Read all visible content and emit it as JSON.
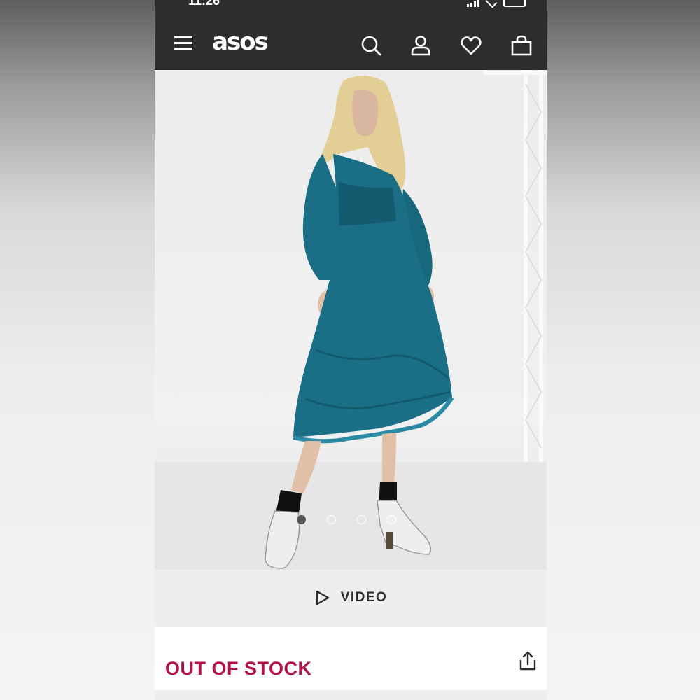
{
  "status_bar": {
    "time": "11:26"
  },
  "header": {
    "logo_text": "asos",
    "icons": [
      "menu-icon",
      "search-icon",
      "account-icon",
      "heart-icon",
      "bag-icon"
    ]
  },
  "gallery": {
    "image_count": 4,
    "active_index": 0,
    "dress_color": "#1a6f86"
  },
  "video": {
    "label": "VIDEO",
    "icon": "play-icon"
  },
  "product": {
    "stock_status": "OUT OF STOCK",
    "share_icon": "share-icon"
  },
  "colors": {
    "header_bg": "#2d2d2d",
    "out_of_stock": "#b0124a",
    "video_bar_bg": "#eeeeee"
  }
}
